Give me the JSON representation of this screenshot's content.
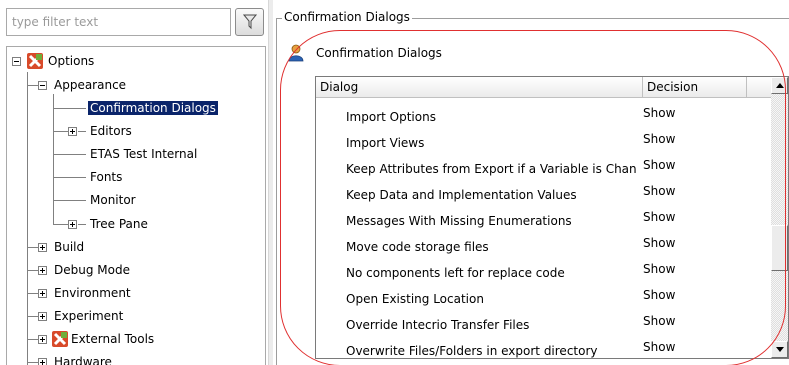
{
  "filter": {
    "placeholder": "type filter text"
  },
  "tree": {
    "root": "Options",
    "appearance": "Appearance",
    "appearance_children": [
      "Confirmation Dialogs",
      "Editors",
      "ETAS Test Internal",
      "Fonts",
      "Monitor",
      "Tree Pane"
    ],
    "top_items": [
      "Build",
      "Debug Mode",
      "Environment",
      "Experiment",
      "External Tools",
      "Hardware"
    ],
    "selected": "Confirmation Dialogs"
  },
  "group": {
    "title": "Confirmation Dialogs"
  },
  "page": {
    "title": "Confirmation Dialogs"
  },
  "table": {
    "headers": [
      "Dialog",
      "Decision"
    ],
    "rows": [
      {
        "dialog": "Import Options",
        "decision": "Show"
      },
      {
        "dialog": "Import Views",
        "decision": "Show"
      },
      {
        "dialog": "Keep Attributes from Export if a Variable is Chan",
        "decision": "Show"
      },
      {
        "dialog": "Keep Data and Implementation Values",
        "decision": "Show"
      },
      {
        "dialog": "Messages With Missing Enumerations",
        "decision": "Show"
      },
      {
        "dialog": "Move code storage files",
        "decision": "Show"
      },
      {
        "dialog": "No components left for replace code",
        "decision": "Show"
      },
      {
        "dialog": "Open Existing Location",
        "decision": "Show"
      },
      {
        "dialog": "Override Intecrio Transfer Files",
        "decision": "Show"
      },
      {
        "dialog": "Overwrite Files/Folders in export directory",
        "decision": "Show"
      }
    ]
  },
  "colors": {
    "selection": "#0a246a",
    "highlight_ring": "#e03030"
  },
  "icons": {
    "filter": "funnel-icon",
    "options": "options-icon",
    "page": "user-icon"
  }
}
